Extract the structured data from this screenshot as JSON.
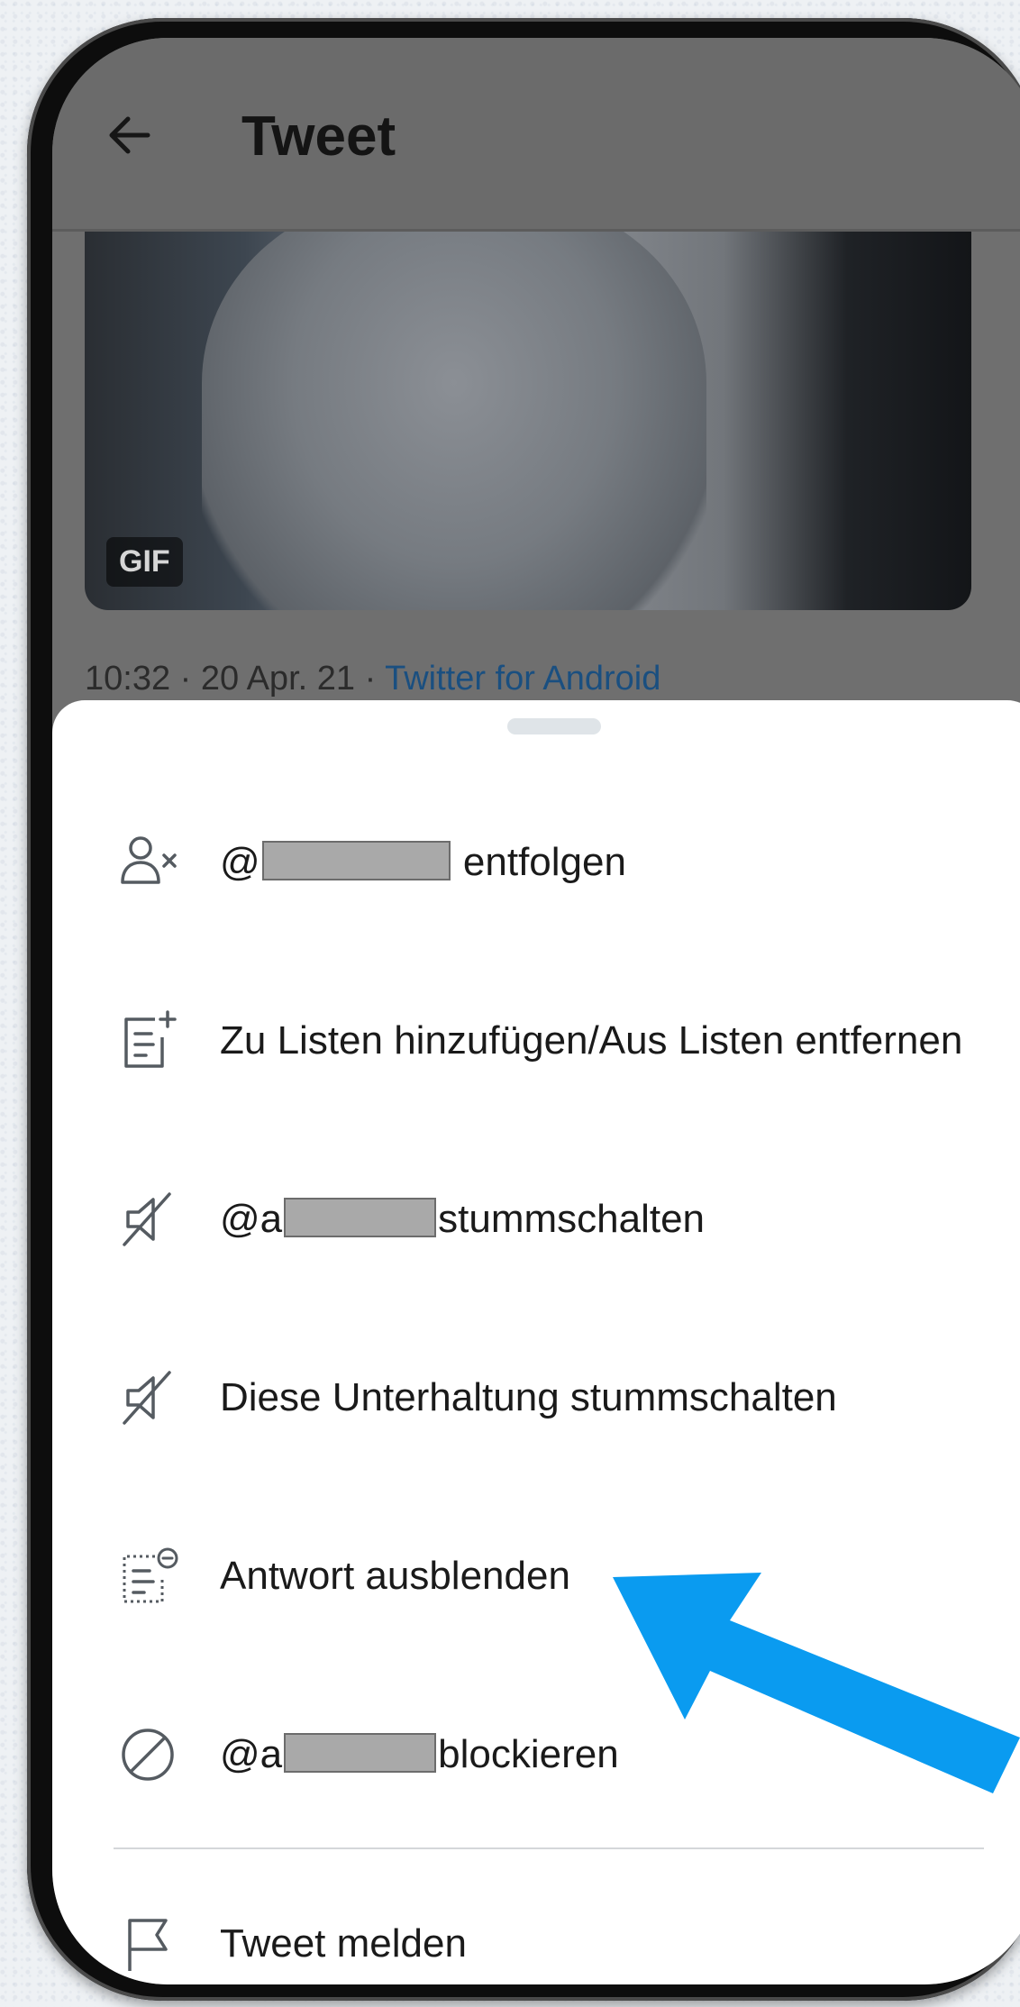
{
  "header": {
    "title": "Tweet"
  },
  "media": {
    "badge": "GIF"
  },
  "tweet_meta": {
    "time_date": "10:32 · 20 Apr. 21 · ",
    "source": "Twitter for Android"
  },
  "menu": {
    "unfollow": {
      "prefix": "@",
      "suffix": " entfolgen",
      "icon": "unfollow-user-icon"
    },
    "lists": {
      "label": "Zu Listen hinzufügen/Aus Listen entfernen",
      "icon": "add-to-list-icon"
    },
    "mute_user": {
      "prefix": "@a",
      "suffix": "stummschalten",
      "icon": "mute-icon"
    },
    "mute_conversation": {
      "label": "Diese Unterhaltung stummschalten",
      "icon": "mute-icon"
    },
    "hide_reply": {
      "label": "Antwort ausblenden",
      "icon": "hide-reply-icon"
    },
    "block_user": {
      "prefix": "@a",
      "suffix": "blockieren",
      "icon": "block-icon"
    },
    "report": {
      "label": "Tweet melden",
      "icon": "flag-icon"
    }
  },
  "colors": {
    "accent": "#1da1f2",
    "annotation_arrow": "#0a9bf0",
    "dim_overlay": "#6f6f6f"
  }
}
